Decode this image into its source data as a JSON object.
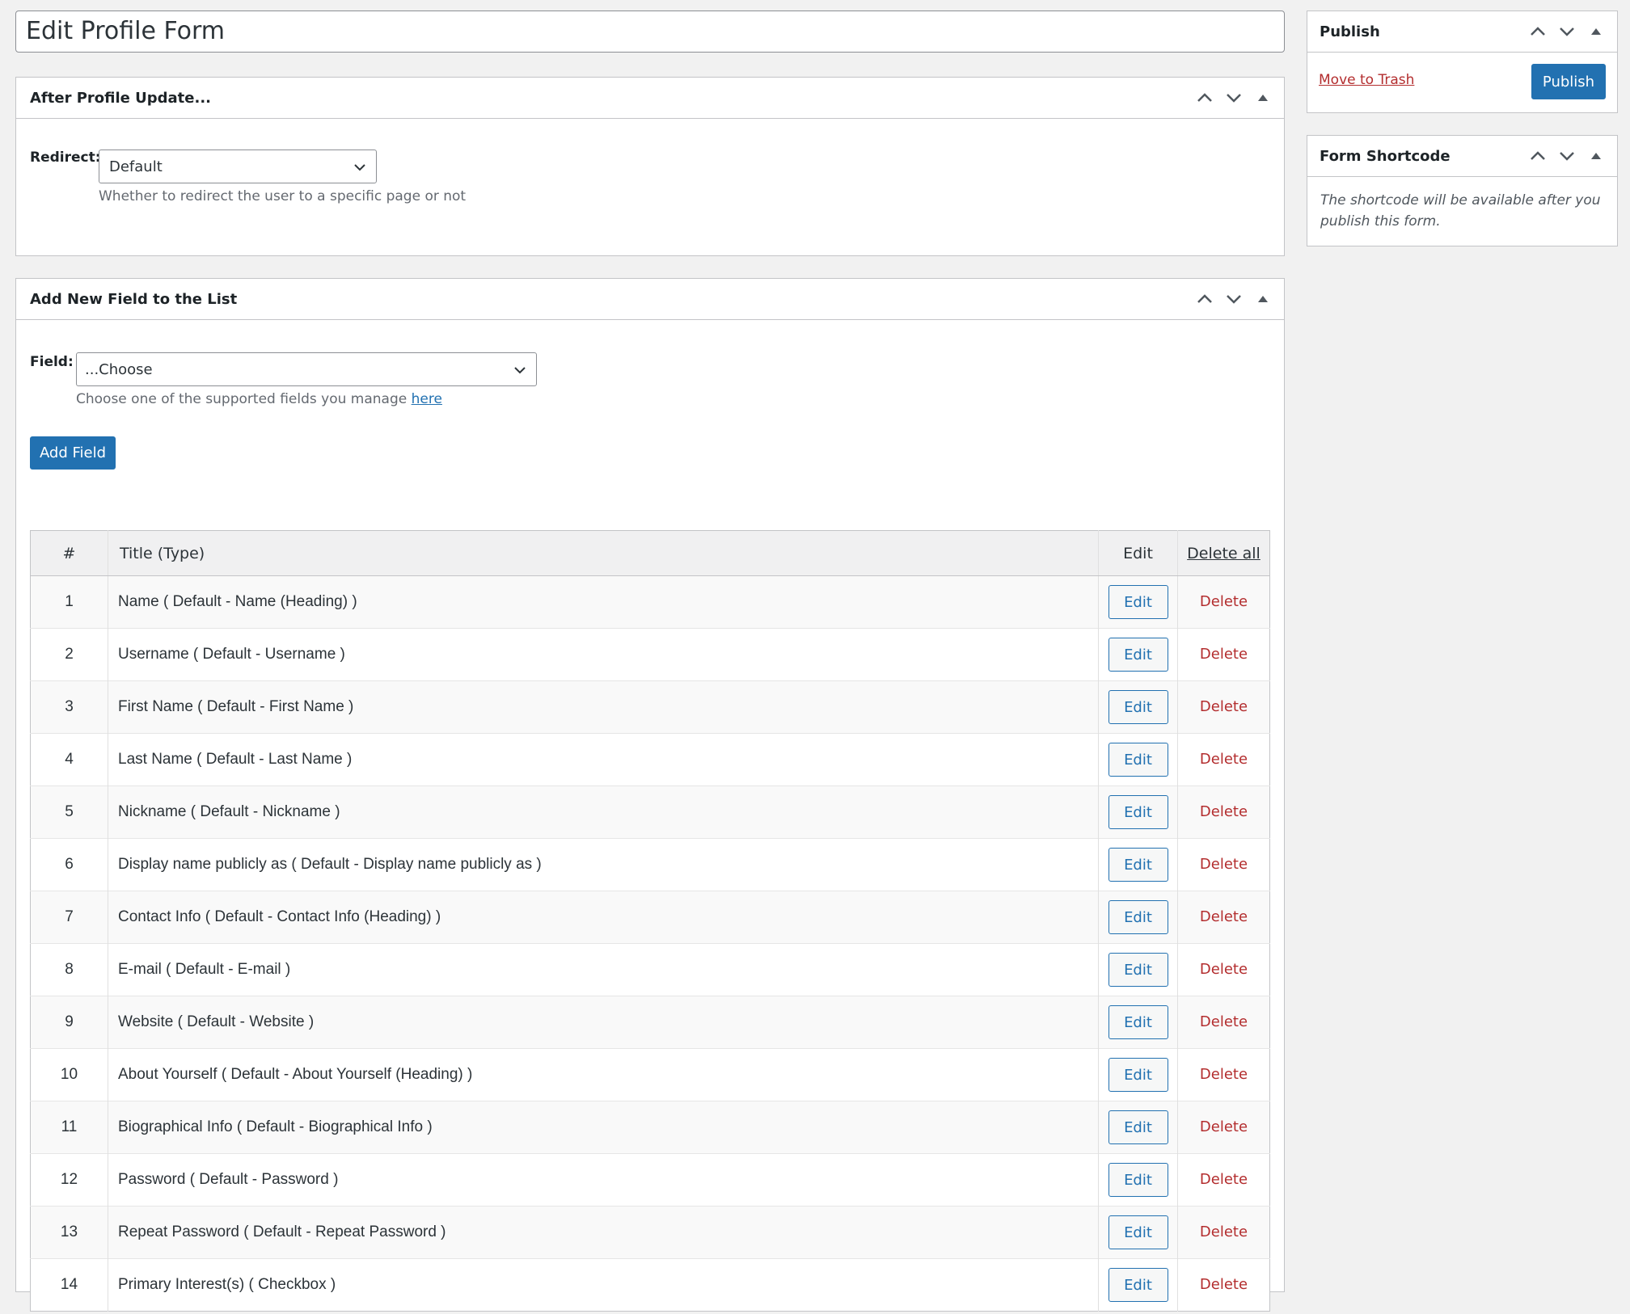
{
  "title_field": {
    "value": "Edit Profile Form"
  },
  "after_update": {
    "title": "After Profile Update...",
    "redirect_label": "Redirect:",
    "redirect_value": "Default",
    "redirect_desc": "Whether to redirect the user to a specific page or not"
  },
  "add_field": {
    "title": "Add New Field to the List",
    "field_label": "Field:",
    "field_value": "...Choose",
    "field_desc": "Choose one of the supported fields you manage",
    "field_desc_link": "here",
    "add_button": "Add Field",
    "table": {
      "headers": {
        "num": "#",
        "title": "Title (Type)",
        "edit": "Edit",
        "delete_all": "Delete all"
      },
      "edit_label": "Edit",
      "delete_label": "Delete",
      "rows": [
        {
          "num": "1",
          "title": "Name ( Default - Name (Heading) )"
        },
        {
          "num": "2",
          "title": "Username ( Default - Username )"
        },
        {
          "num": "3",
          "title": "First Name ( Default - First Name )"
        },
        {
          "num": "4",
          "title": "Last Name ( Default - Last Name )"
        },
        {
          "num": "5",
          "title": "Nickname ( Default - Nickname )"
        },
        {
          "num": "6",
          "title": "Display name publicly as ( Default - Display name publicly as )"
        },
        {
          "num": "7",
          "title": "Contact Info ( Default - Contact Info (Heading) )"
        },
        {
          "num": "8",
          "title": "E-mail ( Default - E-mail )"
        },
        {
          "num": "9",
          "title": "Website ( Default - Website )"
        },
        {
          "num": "10",
          "title": "About Yourself ( Default - About Yourself (Heading) )"
        },
        {
          "num": "11",
          "title": "Biographical Info ( Default - Biographical Info )"
        },
        {
          "num": "12",
          "title": "Password ( Default - Password )"
        },
        {
          "num": "13",
          "title": "Repeat Password ( Default - Repeat Password )"
        },
        {
          "num": "14",
          "title": "Primary Interest(s) ( Checkbox )"
        }
      ]
    }
  },
  "publish": {
    "title": "Publish",
    "trash_link": "Move to Trash",
    "publish_button": "Publish"
  },
  "shortcode": {
    "title": "Form Shortcode",
    "text": "The shortcode will be available after you publish this form."
  },
  "colors": {
    "primary": "#2271b1",
    "danger": "#b32d2e",
    "background": "#f1f1f1"
  },
  "icons": [
    "chevron-up-icon",
    "chevron-down-icon",
    "caret-up-icon",
    "dropdown-chevron-icon"
  ]
}
